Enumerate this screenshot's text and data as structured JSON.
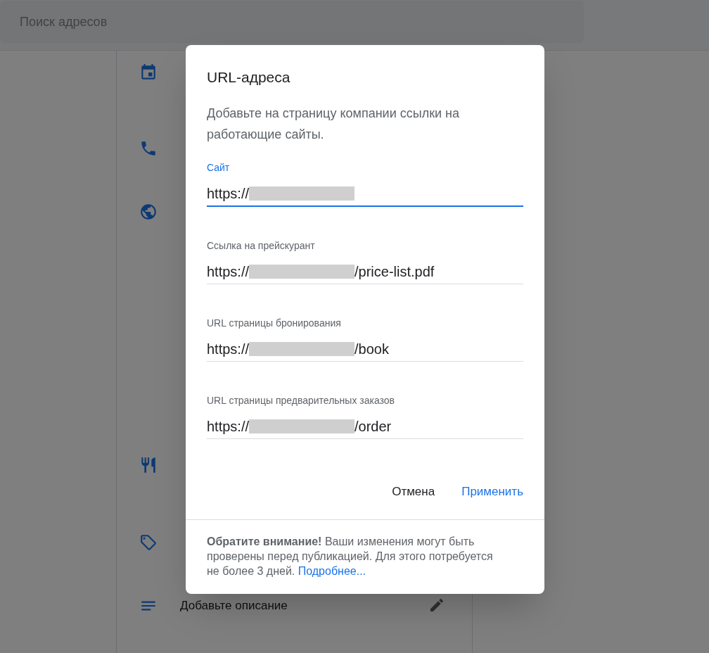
{
  "search": {
    "placeholder": "Поиск адресов"
  },
  "background_items": [
    {
      "kind": "calendar"
    },
    {
      "kind": "phone"
    },
    {
      "kind": "globe"
    },
    {
      "kind": "cutlery"
    },
    {
      "kind": "tag"
    },
    {
      "kind": "lines",
      "text": "Добавьте описание"
    }
  ],
  "dialog": {
    "title": "URL-адреса",
    "description": "Добавьте на страницу компании ссылки на работающие сайты.",
    "fields": [
      {
        "label": "Сайт",
        "prefix": "https://",
        "focused": true
      },
      {
        "label": "Ссылка на прейскурант",
        "prefix": "https://",
        "suffix": "/price-list.pdf",
        "focused": false
      },
      {
        "label": "URL страницы бронирования",
        "prefix": "https://",
        "suffix": "/book",
        "focused": false
      },
      {
        "label": "URL страницы предварительных заказов",
        "prefix": "https://",
        "suffix": "/order",
        "focused": false
      }
    ],
    "buttons": [
      {
        "label": "Отмена",
        "kind": "secondary"
      },
      {
        "label": "Применить",
        "kind": "primary"
      }
    ],
    "note": "**Обратите внимание!** Ваши изменения могут быть проверены перед публикацией. Для этого потребуется не более 3 дней.",
    "note_link": "Подробнее..."
  }
}
